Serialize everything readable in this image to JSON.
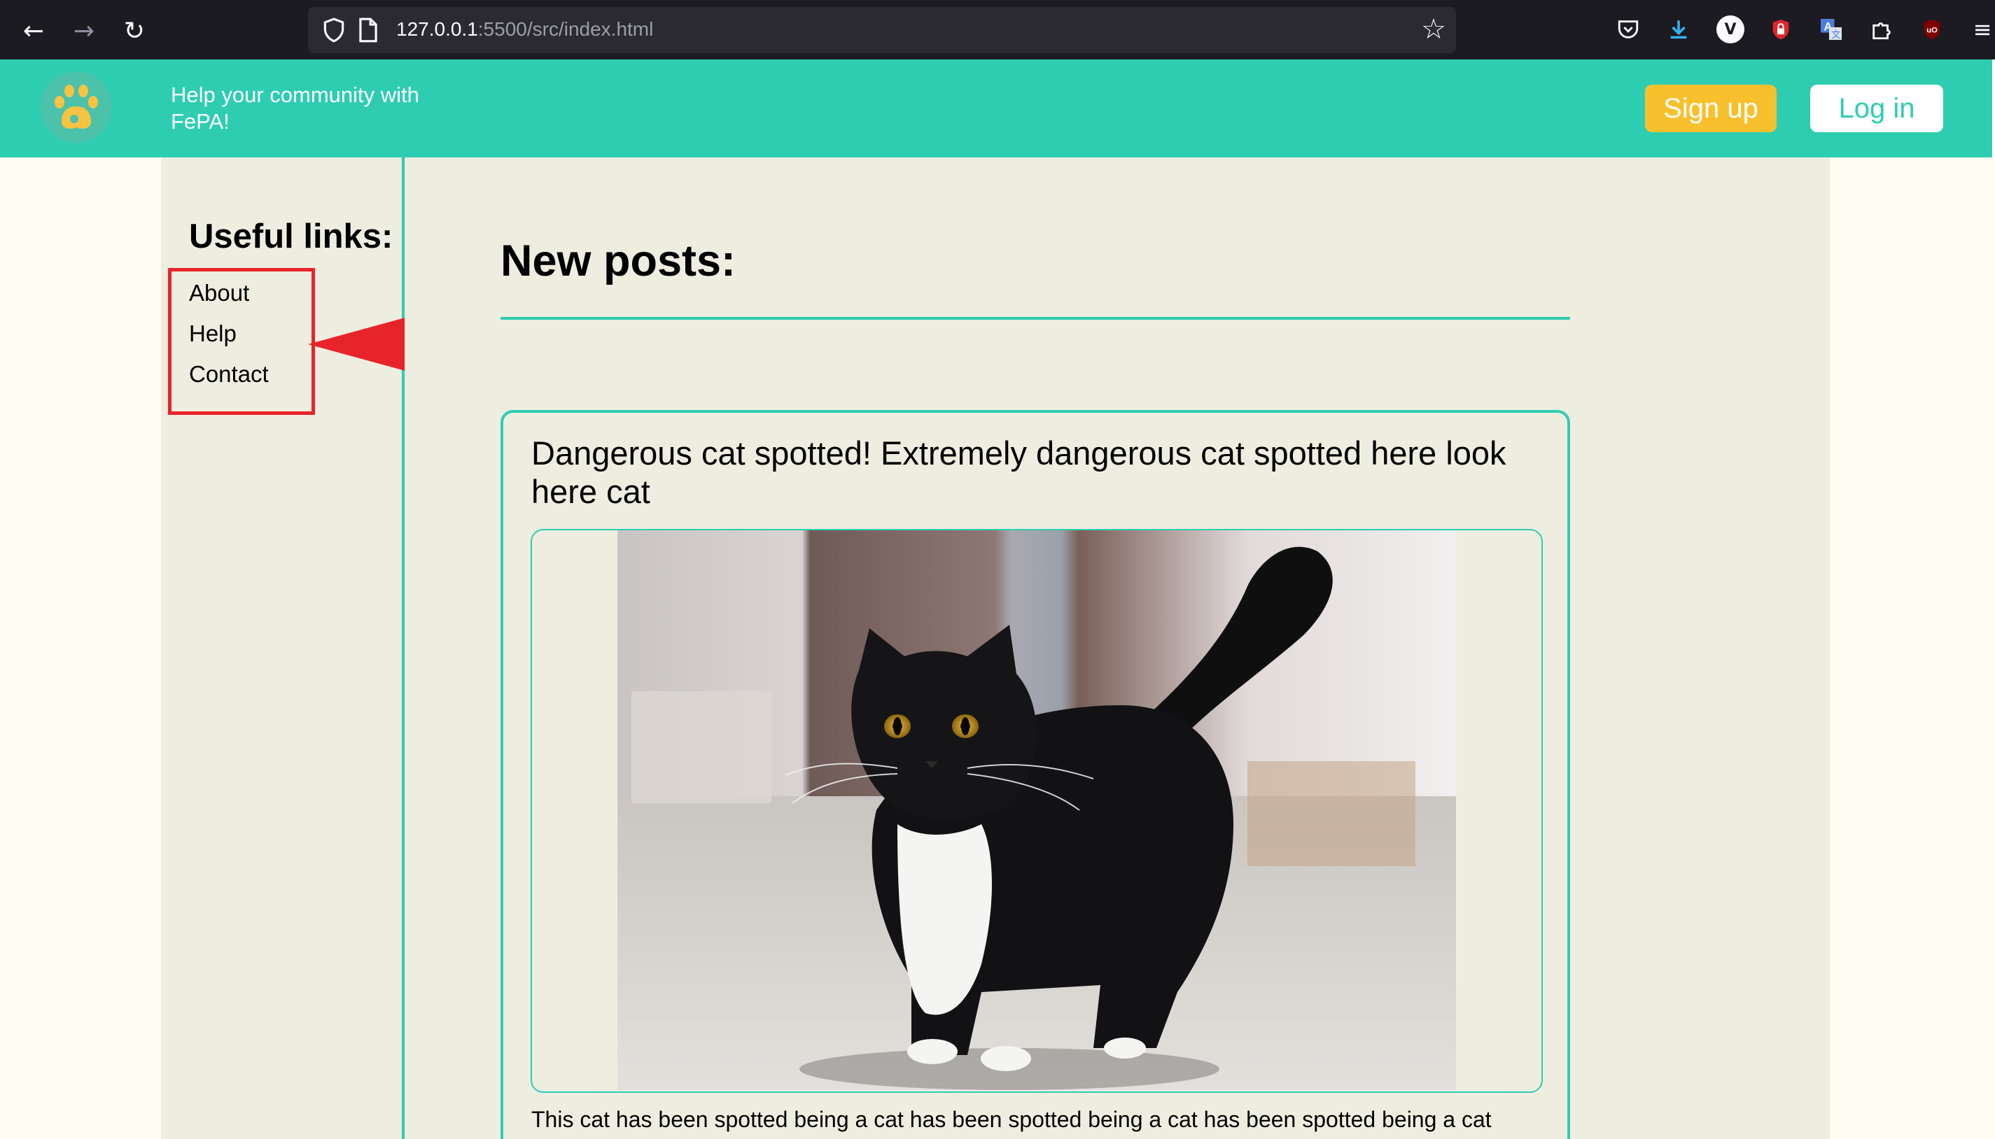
{
  "browser": {
    "url_host": "127.0.0.1",
    "url_path": ":5500/src/index.html"
  },
  "header": {
    "tagline": "Help your community with FePA!",
    "signup_label": "Sign up",
    "login_label": "Log in"
  },
  "sidebar": {
    "title": "Useful links:",
    "links": [
      "About",
      "Help",
      "Contact"
    ]
  },
  "main": {
    "title": "New posts:",
    "post": {
      "title": "Dangerous cat spotted! Extremely dangerous cat spotted here look here cat",
      "body": "This cat has been spotted being a cat has been spotted being a cat has been spotted being a cat"
    }
  },
  "colors": {
    "accent": "#2ecdb2",
    "signup": "#f9c02e",
    "annotation": "#e8242b"
  }
}
